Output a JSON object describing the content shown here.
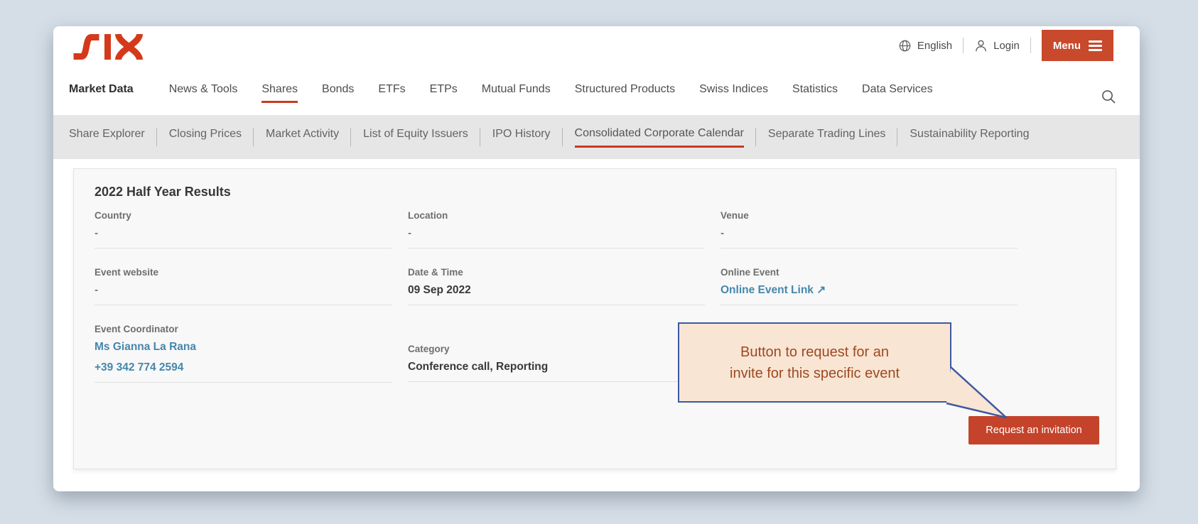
{
  "header": {
    "language_label": "English",
    "login_label": "Login",
    "menu_label": "Menu"
  },
  "nav": {
    "items": [
      "Market Data",
      "News & Tools",
      "Shares",
      "Bonds",
      "ETFs",
      "ETPs",
      "Mutual Funds",
      "Structured Products",
      "Swiss Indices",
      "Statistics",
      "Data Services"
    ],
    "active_item": "Shares"
  },
  "subnav": {
    "items": [
      "Share Explorer",
      "Closing Prices",
      "Market Activity",
      "List of Equity Issuers",
      "IPO History",
      "Consolidated Corporate Calendar",
      "Separate Trading Lines",
      "Sustainability Reporting"
    ],
    "active_item": "Consolidated Corporate Calendar"
  },
  "event": {
    "title": "2022 Half Year Results",
    "country": {
      "label": "Country",
      "value": "-"
    },
    "location": {
      "label": "Location",
      "value": "-"
    },
    "venue": {
      "label": "Venue",
      "value": "-"
    },
    "website": {
      "label": "Event website",
      "value": "-"
    },
    "datetime": {
      "label": "Date & Time",
      "value": "09 Sep 2022"
    },
    "online": {
      "label": "Online Event",
      "link": "Online Event Link",
      "icon": "↗"
    },
    "coordinator": {
      "label": "Event Coordinator",
      "name": "Ms Gianna La Rana",
      "phone": "+39 342 774 2594"
    },
    "category": {
      "label": "Category",
      "value": "Conference call, Reporting"
    }
  },
  "annotation": {
    "line1": "Button to request for an",
    "line2": "invite for this specific event"
  },
  "cta": {
    "label": "Request an invitation"
  },
  "colors": {
    "brand_red": "#d5391b",
    "menu_button_red": "#c8492b",
    "cta_red": "#c4432a",
    "active_underline_red": "#cc3a1e",
    "link_blue": "#4587ac",
    "callout_bg": "#f9e5d4",
    "callout_border": "#3d59a1",
    "callout_text": "#9c4a21",
    "page_bg": "#d5dee7"
  }
}
